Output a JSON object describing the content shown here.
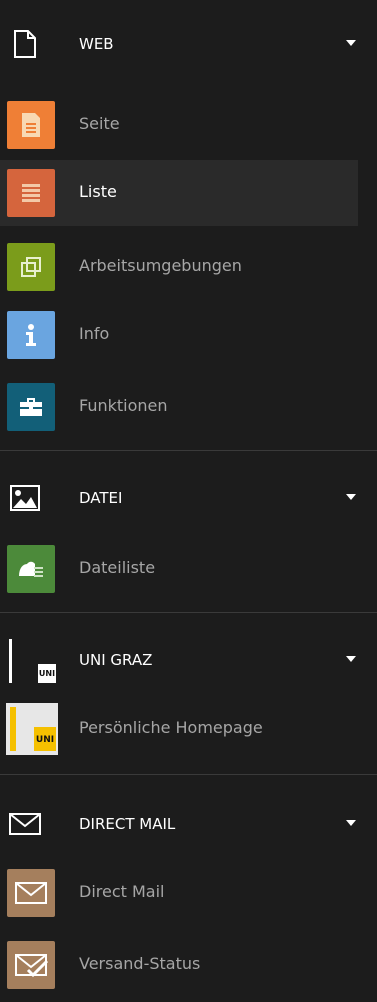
{
  "groups": [
    {
      "title": "WEB",
      "header_icon": "page-icon",
      "items": [
        {
          "label": "Seite",
          "icon": "page-document-icon",
          "color": "#ef7f36"
        },
        {
          "label": "Liste",
          "icon": "list-icon",
          "color": "#d5653d",
          "active": true
        },
        {
          "label": "Arbeitsumgebungen",
          "icon": "workspaces-icon",
          "color": "#7b9c1b"
        },
        {
          "label": "Info",
          "icon": "info-icon",
          "color": "#6aa5e0"
        },
        {
          "label": "Funktionen",
          "icon": "toolbox-icon",
          "color": "#125f78"
        }
      ]
    },
    {
      "title": "DATEI",
      "header_icon": "image-icon",
      "items": [
        {
          "label": "Dateiliste",
          "icon": "file-list-icon",
          "color": "#4c8a3a"
        }
      ]
    },
    {
      "title": "UNI GRAZ",
      "header_icon": "uni-graz-logo-icon",
      "items": [
        {
          "label": "Persönliche Homepage",
          "icon": "uni-graz-homepage-icon",
          "color": "#e7e7e7"
        }
      ]
    },
    {
      "title": "DIRECT MAIL",
      "header_icon": "envelope-icon",
      "items": [
        {
          "label": "Direct Mail",
          "icon": "envelope-icon",
          "color": "#a57f5d"
        },
        {
          "label": "Versand-Status",
          "icon": "envelope-check-icon",
          "color": "#a57f5d"
        }
      ]
    }
  ],
  "colors": {
    "background": "#1c1c1c",
    "active_row": "#2a2a2a",
    "header_text": "#ffffff",
    "item_text": "#a6a6a6",
    "divider": "#3a3a3a"
  },
  "logo_text": {
    "uni_graz": "UNI"
  }
}
